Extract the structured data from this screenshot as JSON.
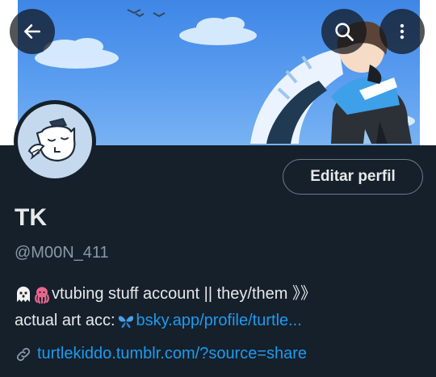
{
  "profile": {
    "display_name": "TK",
    "handle": "@M00N_411",
    "bio_line1_text": "vtubing stuff account || they/them 》》",
    "bio_line2_text": "actual art acc:",
    "bio_line2_link": "bsky.app/profile/turtle...",
    "website": "turtlekiddo.tumblr.com/?source=share"
  },
  "actions": {
    "edit_profile_label": "Editar perfil"
  },
  "icons": {
    "back": "arrow-left-icon",
    "search": "search-icon",
    "more": "more-vertical-icon",
    "website": "link-icon",
    "bio_emojis": [
      "ghost-emoji",
      "octopus-emoji",
      "butterfly-emoji"
    ]
  },
  "colors": {
    "background": "#15202b",
    "primary_text": "#e7e9ea",
    "secondary_text": "#8b98a5",
    "link": "#1d9bf0",
    "button_border": "#6e7b87",
    "banner_sky": "#4a90e8",
    "avatar_bg": "#c5d9ee"
  }
}
